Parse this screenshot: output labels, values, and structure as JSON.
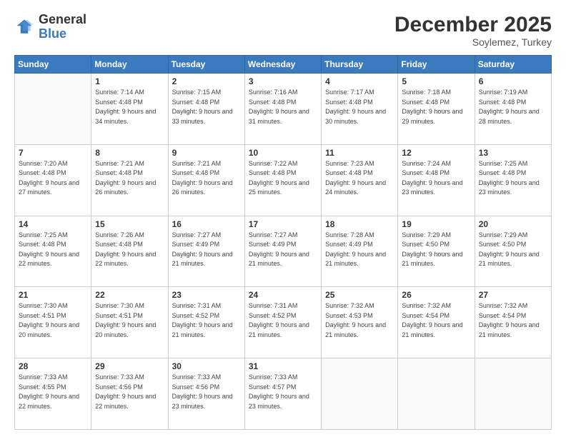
{
  "header": {
    "logo_general": "General",
    "logo_blue": "Blue",
    "month_title": "December 2025",
    "subtitle": "Soylemez, Turkey"
  },
  "weekdays": [
    "Sunday",
    "Monday",
    "Tuesday",
    "Wednesday",
    "Thursday",
    "Friday",
    "Saturday"
  ],
  "weeks": [
    [
      {
        "day": "",
        "sunrise": "",
        "sunset": "",
        "daylight": ""
      },
      {
        "day": "1",
        "sunrise": "Sunrise: 7:14 AM",
        "sunset": "Sunset: 4:48 PM",
        "daylight": "Daylight: 9 hours and 34 minutes."
      },
      {
        "day": "2",
        "sunrise": "Sunrise: 7:15 AM",
        "sunset": "Sunset: 4:48 PM",
        "daylight": "Daylight: 9 hours and 33 minutes."
      },
      {
        "day": "3",
        "sunrise": "Sunrise: 7:16 AM",
        "sunset": "Sunset: 4:48 PM",
        "daylight": "Daylight: 9 hours and 31 minutes."
      },
      {
        "day": "4",
        "sunrise": "Sunrise: 7:17 AM",
        "sunset": "Sunset: 4:48 PM",
        "daylight": "Daylight: 9 hours and 30 minutes."
      },
      {
        "day": "5",
        "sunrise": "Sunrise: 7:18 AM",
        "sunset": "Sunset: 4:48 PM",
        "daylight": "Daylight: 9 hours and 29 minutes."
      },
      {
        "day": "6",
        "sunrise": "Sunrise: 7:19 AM",
        "sunset": "Sunset: 4:48 PM",
        "daylight": "Daylight: 9 hours and 28 minutes."
      }
    ],
    [
      {
        "day": "7",
        "sunrise": "Sunrise: 7:20 AM",
        "sunset": "Sunset: 4:48 PM",
        "daylight": "Daylight: 9 hours and 27 minutes."
      },
      {
        "day": "8",
        "sunrise": "Sunrise: 7:21 AM",
        "sunset": "Sunset: 4:48 PM",
        "daylight": "Daylight: 9 hours and 26 minutes."
      },
      {
        "day": "9",
        "sunrise": "Sunrise: 7:21 AM",
        "sunset": "Sunset: 4:48 PM",
        "daylight": "Daylight: 9 hours and 26 minutes."
      },
      {
        "day": "10",
        "sunrise": "Sunrise: 7:22 AM",
        "sunset": "Sunset: 4:48 PM",
        "daylight": "Daylight: 9 hours and 25 minutes."
      },
      {
        "day": "11",
        "sunrise": "Sunrise: 7:23 AM",
        "sunset": "Sunset: 4:48 PM",
        "daylight": "Daylight: 9 hours and 24 minutes."
      },
      {
        "day": "12",
        "sunrise": "Sunrise: 7:24 AM",
        "sunset": "Sunset: 4:48 PM",
        "daylight": "Daylight: 9 hours and 23 minutes."
      },
      {
        "day": "13",
        "sunrise": "Sunrise: 7:25 AM",
        "sunset": "Sunset: 4:48 PM",
        "daylight": "Daylight: 9 hours and 23 minutes."
      }
    ],
    [
      {
        "day": "14",
        "sunrise": "Sunrise: 7:25 AM",
        "sunset": "Sunset: 4:48 PM",
        "daylight": "Daylight: 9 hours and 22 minutes."
      },
      {
        "day": "15",
        "sunrise": "Sunrise: 7:26 AM",
        "sunset": "Sunset: 4:48 PM",
        "daylight": "Daylight: 9 hours and 22 minutes."
      },
      {
        "day": "16",
        "sunrise": "Sunrise: 7:27 AM",
        "sunset": "Sunset: 4:49 PM",
        "daylight": "Daylight: 9 hours and 21 minutes."
      },
      {
        "day": "17",
        "sunrise": "Sunrise: 7:27 AM",
        "sunset": "Sunset: 4:49 PM",
        "daylight": "Daylight: 9 hours and 21 minutes."
      },
      {
        "day": "18",
        "sunrise": "Sunrise: 7:28 AM",
        "sunset": "Sunset: 4:49 PM",
        "daylight": "Daylight: 9 hours and 21 minutes."
      },
      {
        "day": "19",
        "sunrise": "Sunrise: 7:29 AM",
        "sunset": "Sunset: 4:50 PM",
        "daylight": "Daylight: 9 hours and 21 minutes."
      },
      {
        "day": "20",
        "sunrise": "Sunrise: 7:29 AM",
        "sunset": "Sunset: 4:50 PM",
        "daylight": "Daylight: 9 hours and 21 minutes."
      }
    ],
    [
      {
        "day": "21",
        "sunrise": "Sunrise: 7:30 AM",
        "sunset": "Sunset: 4:51 PM",
        "daylight": "Daylight: 9 hours and 20 minutes."
      },
      {
        "day": "22",
        "sunrise": "Sunrise: 7:30 AM",
        "sunset": "Sunset: 4:51 PM",
        "daylight": "Daylight: 9 hours and 20 minutes."
      },
      {
        "day": "23",
        "sunrise": "Sunrise: 7:31 AM",
        "sunset": "Sunset: 4:52 PM",
        "daylight": "Daylight: 9 hours and 21 minutes."
      },
      {
        "day": "24",
        "sunrise": "Sunrise: 7:31 AM",
        "sunset": "Sunset: 4:52 PM",
        "daylight": "Daylight: 9 hours and 21 minutes."
      },
      {
        "day": "25",
        "sunrise": "Sunrise: 7:32 AM",
        "sunset": "Sunset: 4:53 PM",
        "daylight": "Daylight: 9 hours and 21 minutes."
      },
      {
        "day": "26",
        "sunrise": "Sunrise: 7:32 AM",
        "sunset": "Sunset: 4:54 PM",
        "daylight": "Daylight: 9 hours and 21 minutes."
      },
      {
        "day": "27",
        "sunrise": "Sunrise: 7:32 AM",
        "sunset": "Sunset: 4:54 PM",
        "daylight": "Daylight: 9 hours and 21 minutes."
      }
    ],
    [
      {
        "day": "28",
        "sunrise": "Sunrise: 7:33 AM",
        "sunset": "Sunset: 4:55 PM",
        "daylight": "Daylight: 9 hours and 22 minutes."
      },
      {
        "day": "29",
        "sunrise": "Sunrise: 7:33 AM",
        "sunset": "Sunset: 4:56 PM",
        "daylight": "Daylight: 9 hours and 22 minutes."
      },
      {
        "day": "30",
        "sunrise": "Sunrise: 7:33 AM",
        "sunset": "Sunset: 4:56 PM",
        "daylight": "Daylight: 9 hours and 23 minutes."
      },
      {
        "day": "31",
        "sunrise": "Sunrise: 7:33 AM",
        "sunset": "Sunset: 4:57 PM",
        "daylight": "Daylight: 9 hours and 23 minutes."
      },
      {
        "day": "",
        "sunrise": "",
        "sunset": "",
        "daylight": ""
      },
      {
        "day": "",
        "sunrise": "",
        "sunset": "",
        "daylight": ""
      },
      {
        "day": "",
        "sunrise": "",
        "sunset": "",
        "daylight": ""
      }
    ]
  ]
}
